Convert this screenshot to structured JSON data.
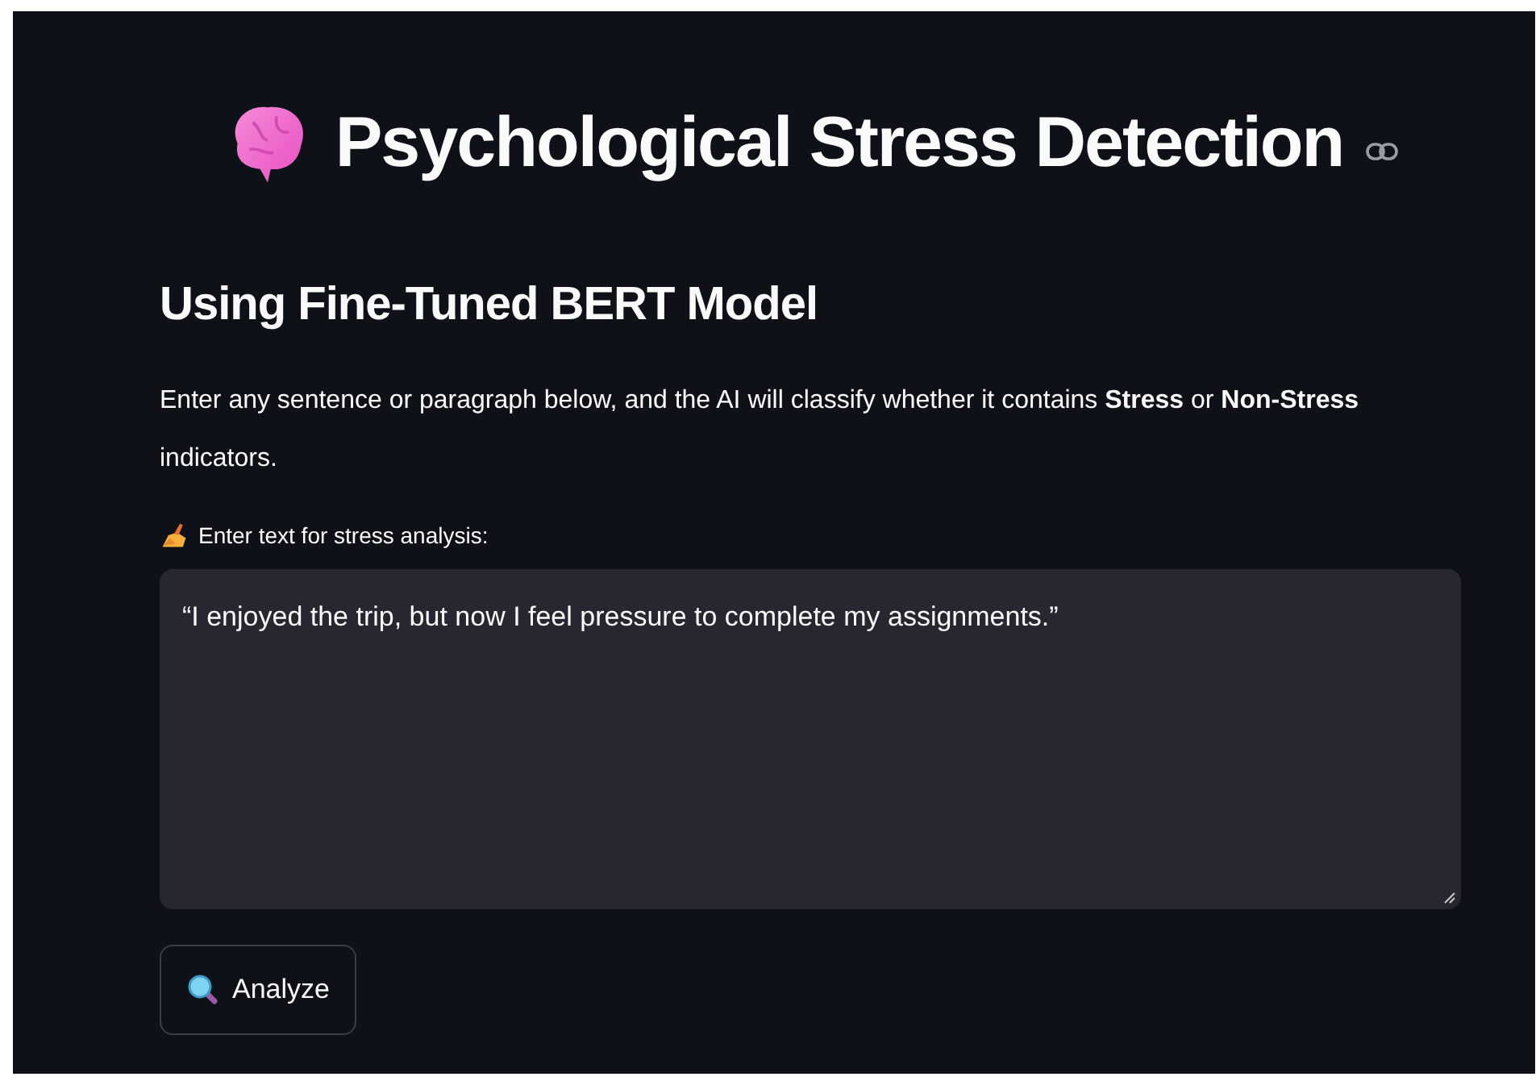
{
  "title": "Psychological Stress Detection",
  "subtitle": "Using Fine-Tuned BERT Model",
  "description": "Enter any sentence or paragraph below, and the AI will classify whether it contains **Stress** or **Non-Stress** indicators.",
  "text_area": {
    "label": "Enter text for stress analysis:",
    "value": "“I enjoyed the trip, but now I feel pressure to complete my assignments.”"
  },
  "buttons": [
    {
      "label": "Analyze"
    }
  ]
}
